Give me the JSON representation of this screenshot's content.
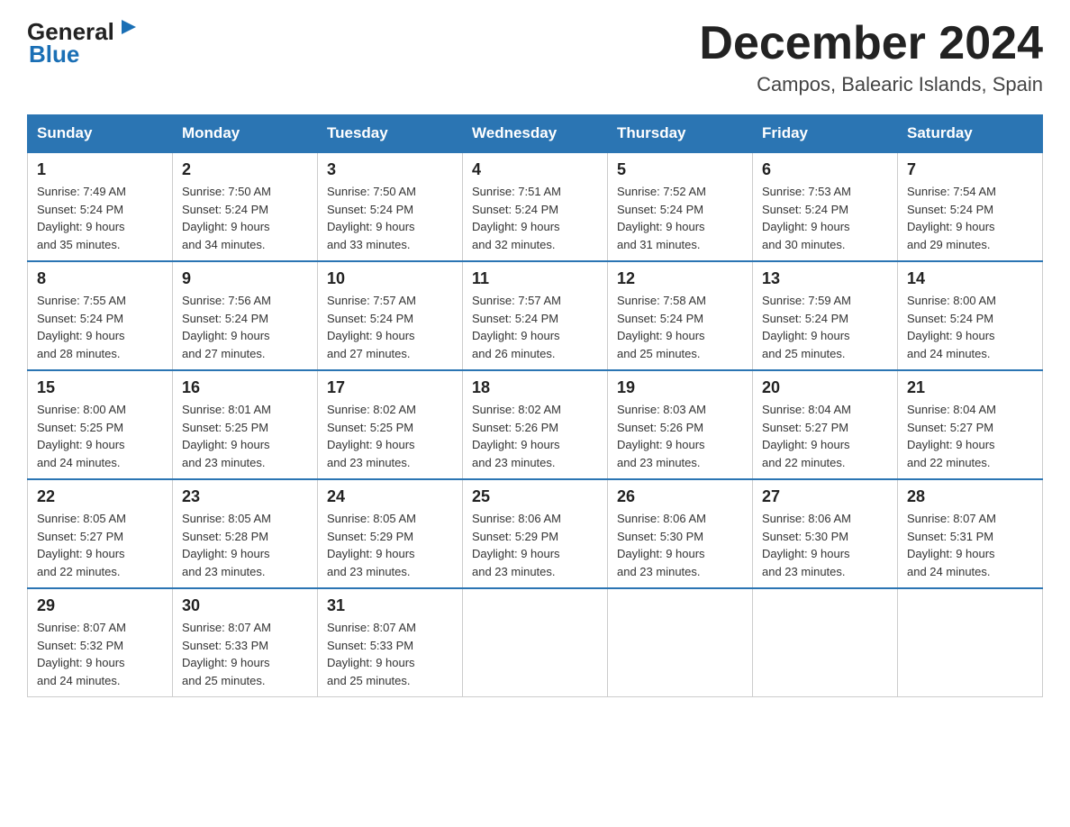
{
  "header": {
    "month_year": "December 2024",
    "location": "Campos, Balearic Islands, Spain",
    "logo_general": "General",
    "logo_blue": "Blue"
  },
  "days_of_week": [
    "Sunday",
    "Monday",
    "Tuesday",
    "Wednesday",
    "Thursday",
    "Friday",
    "Saturday"
  ],
  "weeks": [
    [
      {
        "day": "1",
        "sunrise": "7:49 AM",
        "sunset": "5:24 PM",
        "daylight": "9 hours and 35 minutes."
      },
      {
        "day": "2",
        "sunrise": "7:50 AM",
        "sunset": "5:24 PM",
        "daylight": "9 hours and 34 minutes."
      },
      {
        "day": "3",
        "sunrise": "7:50 AM",
        "sunset": "5:24 PM",
        "daylight": "9 hours and 33 minutes."
      },
      {
        "day": "4",
        "sunrise": "7:51 AM",
        "sunset": "5:24 PM",
        "daylight": "9 hours and 32 minutes."
      },
      {
        "day": "5",
        "sunrise": "7:52 AM",
        "sunset": "5:24 PM",
        "daylight": "9 hours and 31 minutes."
      },
      {
        "day": "6",
        "sunrise": "7:53 AM",
        "sunset": "5:24 PM",
        "daylight": "9 hours and 30 minutes."
      },
      {
        "day": "7",
        "sunrise": "7:54 AM",
        "sunset": "5:24 PM",
        "daylight": "9 hours and 29 minutes."
      }
    ],
    [
      {
        "day": "8",
        "sunrise": "7:55 AM",
        "sunset": "5:24 PM",
        "daylight": "9 hours and 28 minutes."
      },
      {
        "day": "9",
        "sunrise": "7:56 AM",
        "sunset": "5:24 PM",
        "daylight": "9 hours and 27 minutes."
      },
      {
        "day": "10",
        "sunrise": "7:57 AM",
        "sunset": "5:24 PM",
        "daylight": "9 hours and 27 minutes."
      },
      {
        "day": "11",
        "sunrise": "7:57 AM",
        "sunset": "5:24 PM",
        "daylight": "9 hours and 26 minutes."
      },
      {
        "day": "12",
        "sunrise": "7:58 AM",
        "sunset": "5:24 PM",
        "daylight": "9 hours and 25 minutes."
      },
      {
        "day": "13",
        "sunrise": "7:59 AM",
        "sunset": "5:24 PM",
        "daylight": "9 hours and 25 minutes."
      },
      {
        "day": "14",
        "sunrise": "8:00 AM",
        "sunset": "5:24 PM",
        "daylight": "9 hours and 24 minutes."
      }
    ],
    [
      {
        "day": "15",
        "sunrise": "8:00 AM",
        "sunset": "5:25 PM",
        "daylight": "9 hours and 24 minutes."
      },
      {
        "day": "16",
        "sunrise": "8:01 AM",
        "sunset": "5:25 PM",
        "daylight": "9 hours and 23 minutes."
      },
      {
        "day": "17",
        "sunrise": "8:02 AM",
        "sunset": "5:25 PM",
        "daylight": "9 hours and 23 minutes."
      },
      {
        "day": "18",
        "sunrise": "8:02 AM",
        "sunset": "5:26 PM",
        "daylight": "9 hours and 23 minutes."
      },
      {
        "day": "19",
        "sunrise": "8:03 AM",
        "sunset": "5:26 PM",
        "daylight": "9 hours and 23 minutes."
      },
      {
        "day": "20",
        "sunrise": "8:04 AM",
        "sunset": "5:27 PM",
        "daylight": "9 hours and 22 minutes."
      },
      {
        "day": "21",
        "sunrise": "8:04 AM",
        "sunset": "5:27 PM",
        "daylight": "9 hours and 22 minutes."
      }
    ],
    [
      {
        "day": "22",
        "sunrise": "8:05 AM",
        "sunset": "5:27 PM",
        "daylight": "9 hours and 22 minutes."
      },
      {
        "day": "23",
        "sunrise": "8:05 AM",
        "sunset": "5:28 PM",
        "daylight": "9 hours and 23 minutes."
      },
      {
        "day": "24",
        "sunrise": "8:05 AM",
        "sunset": "5:29 PM",
        "daylight": "9 hours and 23 minutes."
      },
      {
        "day": "25",
        "sunrise": "8:06 AM",
        "sunset": "5:29 PM",
        "daylight": "9 hours and 23 minutes."
      },
      {
        "day": "26",
        "sunrise": "8:06 AM",
        "sunset": "5:30 PM",
        "daylight": "9 hours and 23 minutes."
      },
      {
        "day": "27",
        "sunrise": "8:06 AM",
        "sunset": "5:30 PM",
        "daylight": "9 hours and 23 minutes."
      },
      {
        "day": "28",
        "sunrise": "8:07 AM",
        "sunset": "5:31 PM",
        "daylight": "9 hours and 24 minutes."
      }
    ],
    [
      {
        "day": "29",
        "sunrise": "8:07 AM",
        "sunset": "5:32 PM",
        "daylight": "9 hours and 24 minutes."
      },
      {
        "day": "30",
        "sunrise": "8:07 AM",
        "sunset": "5:33 PM",
        "daylight": "9 hours and 25 minutes."
      },
      {
        "day": "31",
        "sunrise": "8:07 AM",
        "sunset": "5:33 PM",
        "daylight": "9 hours and 25 minutes."
      },
      null,
      null,
      null,
      null
    ]
  ],
  "labels": {
    "sunrise": "Sunrise:",
    "sunset": "Sunset:",
    "daylight": "Daylight:"
  }
}
